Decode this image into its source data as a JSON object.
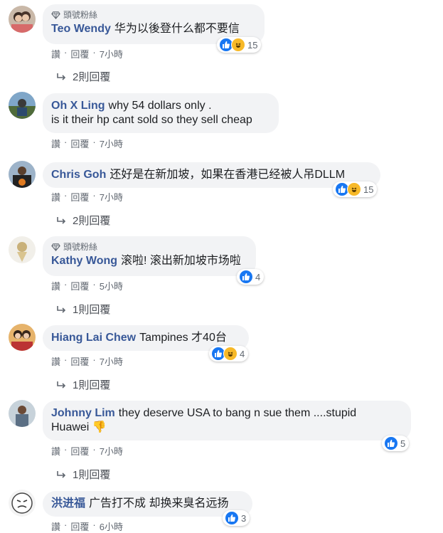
{
  "fan_badge": "頭號粉絲",
  "actions": {
    "like": "讚",
    "reply": "回覆",
    "sep": "·"
  },
  "comments": [
    {
      "author": "Teo Wendy",
      "text": "华为以後登什么都不要信",
      "fan": true,
      "reactions": [
        "like",
        "haha"
      ],
      "count": "15",
      "time": "7小時",
      "replies": "2則回覆"
    },
    {
      "author": "Oh X Ling",
      "text": "why 54 dollars only .",
      "text2": "is it their hp cant sold so they sell cheap",
      "fan": false,
      "reactions": [],
      "count": "",
      "time": "7小時",
      "replies": ""
    },
    {
      "author": "Chris Goh",
      "text": "还好是在新加坡，如果在香港已经被人吊DLLM",
      "fan": false,
      "reactions": [
        "like",
        "haha"
      ],
      "count": "15",
      "time": "7小時",
      "replies": "2則回覆"
    },
    {
      "author": "Kathy Wong",
      "text": "滚啦! 滚出新加坡市场啦",
      "fan": true,
      "reactions": [
        "like"
      ],
      "count": "4",
      "time": "5小時",
      "replies": "1則回覆"
    },
    {
      "author": "Hiang Lai Chew",
      "text": "Tampines 才40台",
      "fan": false,
      "reactions": [
        "like",
        "haha"
      ],
      "count": "4",
      "time": "7小時",
      "replies": "1則回覆"
    },
    {
      "author": "Johnny Lim",
      "text": "they deserve USA to bang n sue them ....stupid",
      "text2": "Huawei 👎",
      "fan": false,
      "reactions": [
        "like"
      ],
      "count": "5",
      "time": "7小時",
      "replies": "1則回覆"
    },
    {
      "author": "洪进福",
      "text": "广告打不成 却换来臭名远扬",
      "fan": false,
      "reactions": [
        "like"
      ],
      "count": "3",
      "time": "6小時",
      "replies": ""
    }
  ],
  "colors": {
    "author": "#385898",
    "bubble": "#f2f3f5",
    "like": "#1877f2",
    "haha": "#f7b928",
    "meta": "#606770"
  }
}
